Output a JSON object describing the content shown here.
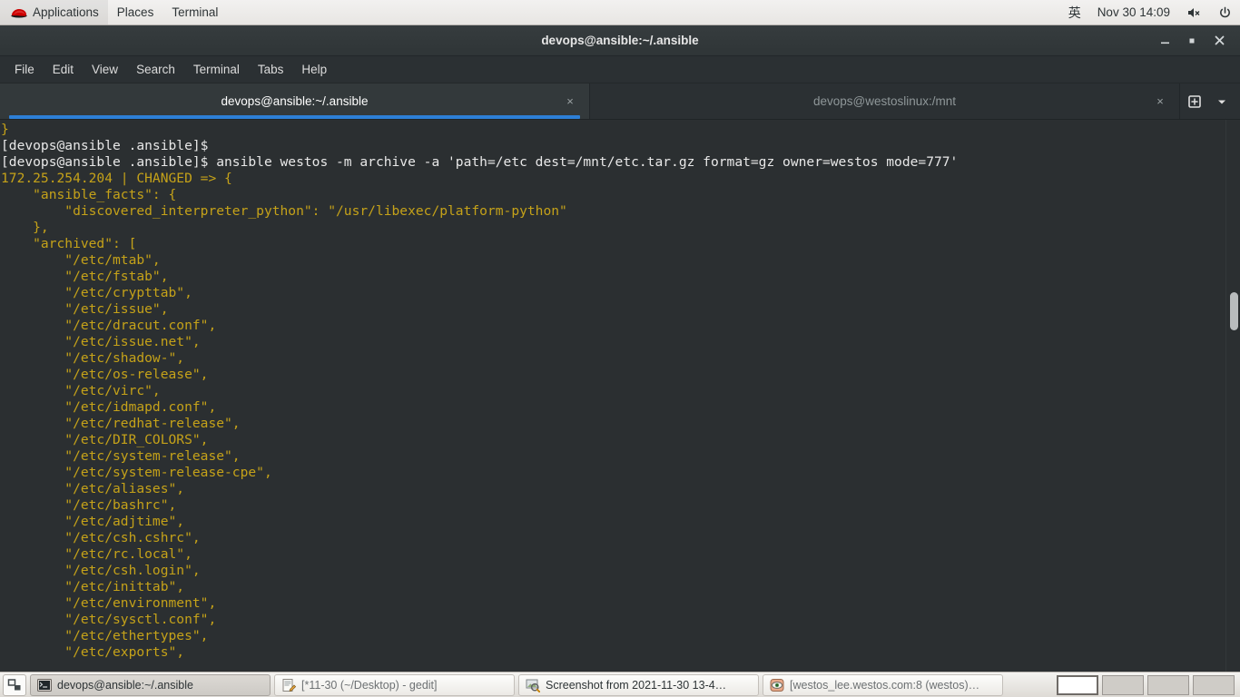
{
  "top_panel": {
    "logo_icon": "redhat-logo-icon",
    "items": [
      {
        "label": "Applications",
        "name": "applications-menu"
      },
      {
        "label": "Places",
        "name": "places-menu"
      },
      {
        "label": "Terminal",
        "name": "terminal-app-menu"
      }
    ],
    "ime_indicator": "英",
    "clock": "Nov 30  14:09",
    "volume_icon": "volume-muted-icon",
    "power_icon": "power-icon"
  },
  "window": {
    "title": "devops@ansible:~/.ansible",
    "controls": {
      "minimize": "minimize-icon",
      "maximize": "maximize-icon",
      "close": "close-icon"
    }
  },
  "menubar": {
    "items": [
      {
        "label": "File"
      },
      {
        "label": "Edit"
      },
      {
        "label": "View"
      },
      {
        "label": "Search"
      },
      {
        "label": "Terminal"
      },
      {
        "label": "Tabs"
      },
      {
        "label": "Help"
      }
    ]
  },
  "tabs": {
    "items": [
      {
        "label": "devops@ansible:~/.ansible",
        "active": true,
        "close": "×"
      },
      {
        "label": "devops@westoslinux:/mnt",
        "active": false,
        "close": "×"
      }
    ],
    "new_tab_icon": "new-tab-icon",
    "menu_icon": "chevron-down-icon"
  },
  "terminal": {
    "accent_blue": "#2d7fd6",
    "background": "#2b2f31",
    "prompt_color": "#e8e8e8",
    "output_color": "#c5a219",
    "lines": [
      {
        "text": "}",
        "color": "yellow"
      },
      {
        "text": "[devops@ansible .ansible]$",
        "color": "white"
      },
      {
        "text": "[devops@ansible .ansible]$ ansible westos -m archive -a 'path=/etc dest=/mnt/etc.tar.gz format=gz owner=westos mode=777'",
        "color": "white"
      },
      {
        "text": "172.25.254.204 | CHANGED => {",
        "color": "yellow"
      },
      {
        "text": "    \"ansible_facts\": {",
        "color": "yellow"
      },
      {
        "text": "        \"discovered_interpreter_python\": \"/usr/libexec/platform-python\"",
        "color": "yellow"
      },
      {
        "text": "    },",
        "color": "yellow"
      },
      {
        "text": "    \"archived\": [",
        "color": "yellow"
      },
      {
        "text": "        \"/etc/mtab\",",
        "color": "yellow"
      },
      {
        "text": "        \"/etc/fstab\",",
        "color": "yellow"
      },
      {
        "text": "        \"/etc/crypttab\",",
        "color": "yellow"
      },
      {
        "text": "        \"/etc/issue\",",
        "color": "yellow"
      },
      {
        "text": "        \"/etc/dracut.conf\",",
        "color": "yellow"
      },
      {
        "text": "        \"/etc/issue.net\",",
        "color": "yellow"
      },
      {
        "text": "        \"/etc/shadow-\",",
        "color": "yellow"
      },
      {
        "text": "        \"/etc/os-release\",",
        "color": "yellow"
      },
      {
        "text": "        \"/etc/virc\",",
        "color": "yellow"
      },
      {
        "text": "        \"/etc/idmapd.conf\",",
        "color": "yellow"
      },
      {
        "text": "        \"/etc/redhat-release\",",
        "color": "yellow"
      },
      {
        "text": "        \"/etc/DIR_COLORS\",",
        "color": "yellow"
      },
      {
        "text": "        \"/etc/system-release\",",
        "color": "yellow"
      },
      {
        "text": "        \"/etc/system-release-cpe\",",
        "color": "yellow"
      },
      {
        "text": "        \"/etc/aliases\",",
        "color": "yellow"
      },
      {
        "text": "        \"/etc/bashrc\",",
        "color": "yellow"
      },
      {
        "text": "        \"/etc/adjtime\",",
        "color": "yellow"
      },
      {
        "text": "        \"/etc/csh.cshrc\",",
        "color": "yellow"
      },
      {
        "text": "        \"/etc/rc.local\",",
        "color": "yellow"
      },
      {
        "text": "        \"/etc/csh.login\",",
        "color": "yellow"
      },
      {
        "text": "        \"/etc/inittab\",",
        "color": "yellow"
      },
      {
        "text": "        \"/etc/environment\",",
        "color": "yellow"
      },
      {
        "text": "        \"/etc/sysctl.conf\",",
        "color": "yellow"
      },
      {
        "text": "        \"/etc/ethertypes\",",
        "color": "yellow"
      },
      {
        "text": "        \"/etc/exports\",",
        "color": "yellow"
      }
    ]
  },
  "taskbar": {
    "show_desktop_icon": "show-desktop-icon",
    "tasks": [
      {
        "label": "devops@ansible:~/.ansible",
        "icon": "terminal-icon",
        "active": true
      },
      {
        "label": "[*11-30 (~/Desktop) - gedit]",
        "icon": "gedit-icon",
        "active": false
      },
      {
        "label": "Screenshot from 2021-11-30 13-4…",
        "icon": "image-viewer-icon",
        "active": false
      },
      {
        "label": "[westos_lee.westos.com:8 (westos)…",
        "icon": "vnc-viewer-icon",
        "active": false
      }
    ],
    "workspaces": [
      {
        "active": true
      },
      {
        "active": false
      },
      {
        "active": false
      },
      {
        "active": false
      }
    ]
  }
}
